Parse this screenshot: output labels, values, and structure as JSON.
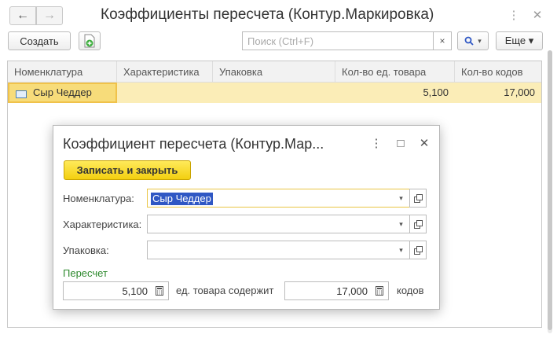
{
  "window": {
    "title": "Коэффициенты пересчета (Контур.Маркировка)",
    "back_icon": "←",
    "forward_icon": "→",
    "more_icon": "⋮",
    "close_icon": "✕"
  },
  "toolbar": {
    "create_label": "Создать",
    "search_placeholder": "Поиск (Ctrl+F)",
    "search_clear": "×",
    "search_button_icon": "🔍▾",
    "more_label": "Еще ▾"
  },
  "table": {
    "columns": [
      "Номенклатура",
      "Характеристика",
      "Упаковка",
      "Кол-во ед. товара",
      "Кол-во кодов"
    ],
    "rows": [
      {
        "nomenclature": "Сыр Чеддер",
        "characteristic": "",
        "package": "",
        "goods_qty": "5,100",
        "codes_qty": "17,000"
      }
    ]
  },
  "modal": {
    "title": "Коэффициент пересчета (Контур.Мар...",
    "more_icon": "⋮",
    "maximize_icon": "□",
    "close_icon": "✕",
    "save_close_label": "Записать и закрыть",
    "nomenclature_label": "Номенклатура:",
    "nomenclature_value": "Сыр Чеддер",
    "characteristic_label": "Характеристика:",
    "characteristic_value": "",
    "package_label": "Упаковка:",
    "package_value": "",
    "group_label": "Пересчет",
    "goods_qty": "5,100",
    "contains_text": "ед. товара содержит",
    "codes_qty": "17,000",
    "codes_text": "кодов",
    "dropdown_icon": "▾"
  },
  "colors": {
    "selected_row": "#fbedb7",
    "primary_button": "#f3cf10",
    "group_label": "#2e8a2e",
    "selection": "#2f57c4"
  }
}
